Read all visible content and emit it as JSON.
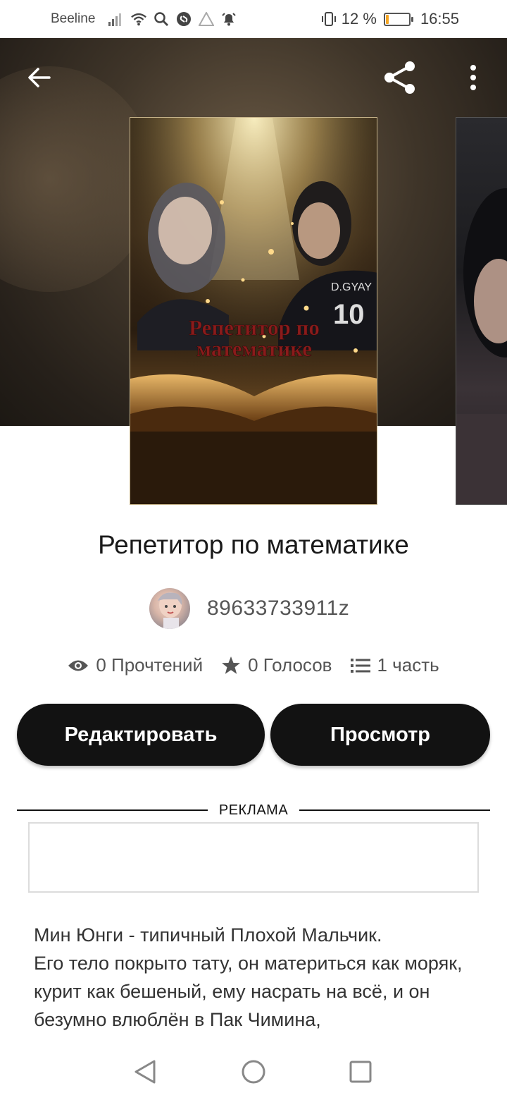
{
  "status_bar": {
    "carrier": "Beeline",
    "battery_text": "12 %",
    "battery_level": 0.12,
    "time": "16:55",
    "icons": [
      "signal-icon",
      "wifi-icon",
      "search-icon",
      "shazam-icon",
      "warning-icon",
      "alarm-icon",
      "vibrate-icon",
      "battery-icon"
    ]
  },
  "toolbar": {
    "back_icon": "arrow-left-icon",
    "share_icon": "share-icon",
    "more_icon": "more-vertical-icon"
  },
  "book": {
    "title": "Репетитор по математике",
    "cover_text": "Репетитор по математике",
    "cover_jersey_text": "D.GYAY",
    "cover_jersey_number": "10",
    "author": "89633733911z"
  },
  "stats": {
    "reads": "0 Прочтений",
    "votes": "0 Голосов",
    "parts": "1 часть"
  },
  "actions": {
    "edit_label": "Редактировать",
    "preview_label": "Просмотр"
  },
  "ad": {
    "label": "РЕКЛАМА"
  },
  "description": {
    "text": "Мин Юнги - типичный Плохой Мальчик.\nЕго тело покрыто тату, он материться как моряк, курит как бешеный, ему насрать на всё, и он безумно влюблён в Пак Чимина,"
  },
  "colors": {
    "button_bg": "#121212",
    "button_text": "#ffffff",
    "text_secondary": "#555555",
    "battery_fill": "#f5a623"
  }
}
